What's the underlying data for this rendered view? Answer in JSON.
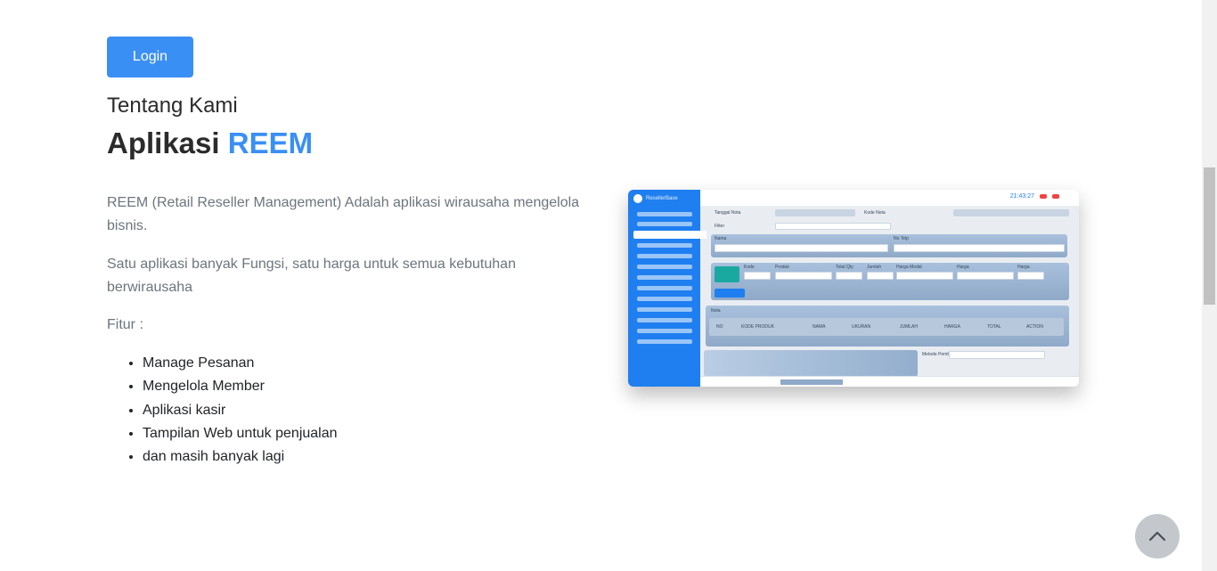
{
  "header": {
    "login_label": "Login"
  },
  "about": {
    "subtitle": "Tentang Kami",
    "title_prefix": "Aplikasi ",
    "title_accent": "REEM",
    "description_1": "REEM (Retail Reseller Management) Adalah aplikasi wirausaha mengelola bisnis.",
    "description_2": "Satu aplikasi banyak Fungsi, satu harga untuk semua kebutuhan berwirausaha",
    "features_label": "Fitur :",
    "features": [
      "Manage Pesanan",
      "Mengelola Member",
      "Aplikasi kasir",
      "Tampilan Web untuk penjualan",
      "dan masih banyak lagi"
    ]
  },
  "mockup": {
    "brand": "ResellerBase",
    "time": "21:43:27",
    "labels": {
      "tanggal_nota": "Tanggal Nota",
      "kode_nota": "Kode Nota",
      "filter": "Filter",
      "nama": "Nama",
      "no_telp": "No Telp",
      "cari_produk": "Cari Produk",
      "kode": "Kode",
      "produk": "Produk",
      "total_qty": "Total Qty",
      "jumlah": "Jumlah",
      "harga_modal": "Harga Modal",
      "harga": "Harga",
      "tambahkan": "Tambahkan",
      "nota": "Nota",
      "metode_pembayaran": "Metode Pembayaran"
    },
    "table_headers": [
      "NO",
      "KODE PRODUK",
      "NAMA",
      "UKURAN",
      "JUMLAH",
      "HARGA",
      "TOTAL",
      "ACTION"
    ]
  },
  "colors": {
    "accent": "#3a8ff5",
    "muted_text": "#6c757d",
    "sidebar": "#1f7ff0"
  },
  "icons": {
    "scroll_top": "chevron-up-icon"
  }
}
